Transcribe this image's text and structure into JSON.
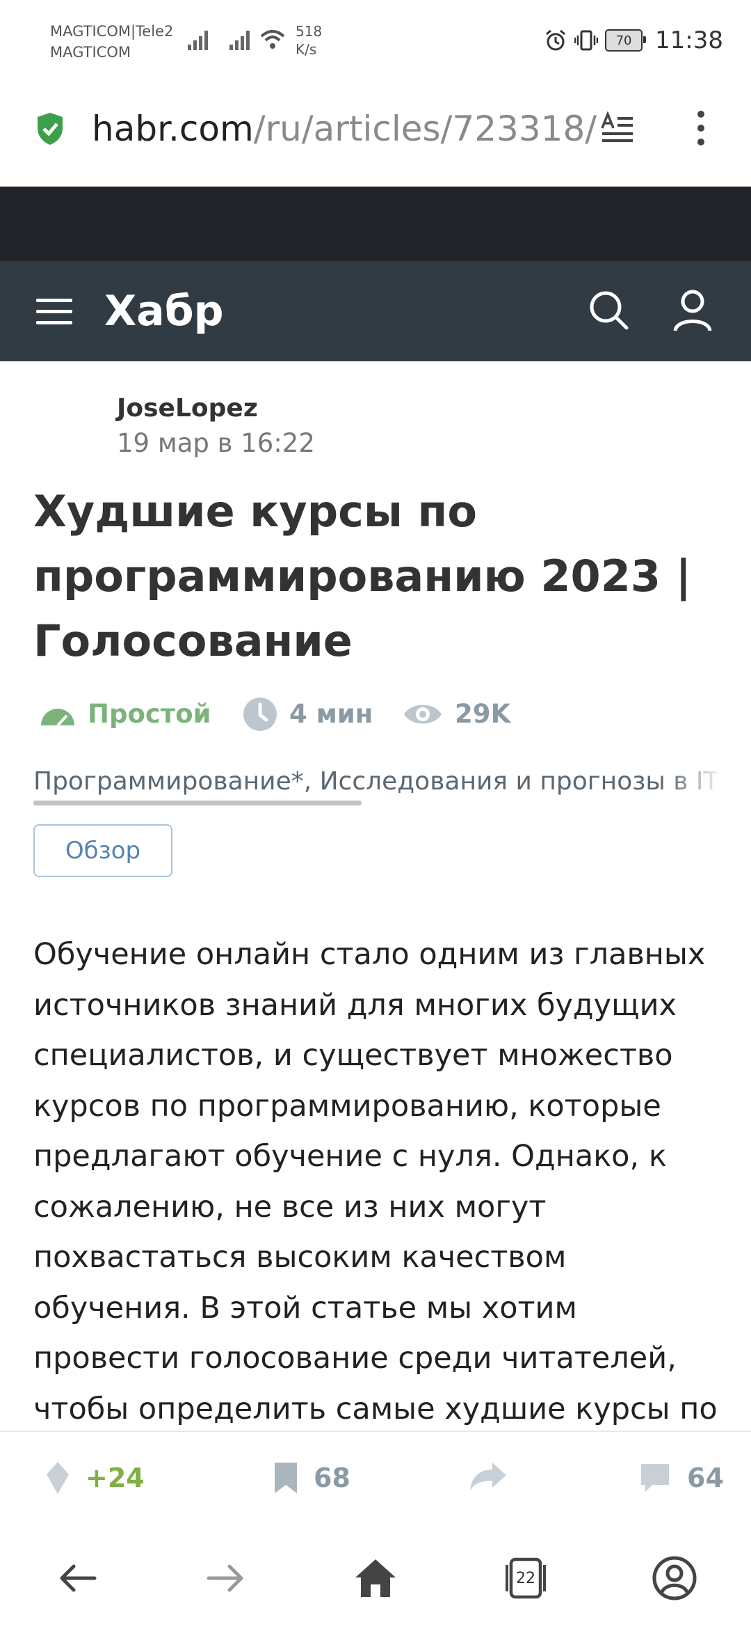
{
  "status_bar": {
    "carrier_1": "MAGTICOM|Tele2",
    "carrier_2": "MAGTICOM",
    "speed_value": "518",
    "speed_unit": "K/s",
    "battery": "70",
    "time": "11:38"
  },
  "browser": {
    "url_domain": "habr.com",
    "url_path": "/ru/articles/723318/",
    "tab_count": "22"
  },
  "site": {
    "logo": "Хабр"
  },
  "article": {
    "author": "JoseLopez",
    "date": "19 мар в 16:22",
    "title": "Худшие курсы по программированию 2023 | Голосование",
    "difficulty": "Простой",
    "read_time": "4 мин",
    "views": "29K",
    "hubs": "Программирование*, Исследования и прогнозы в IT*",
    "tag": "Обзор",
    "body": "Обучение онлайн стало одним из главных источников знаний для многих будущих специалистов, и существует множество курсов по программированию, которые предлагают обучение с нуля. Однако, к сожалению, не все из них могут похвастаться высоким качеством обучения. В этой статье мы хотим провести голосование среди читателей, чтобы определить самые худшие курсы по"
  },
  "actions": {
    "score": "+24",
    "bookmarks": "68",
    "comments": "64"
  },
  "colors": {
    "header_bg": "#303b44",
    "accent_green": "#7fb043",
    "difficulty_green": "#7bb37b",
    "tag_blue": "#5684b2"
  }
}
